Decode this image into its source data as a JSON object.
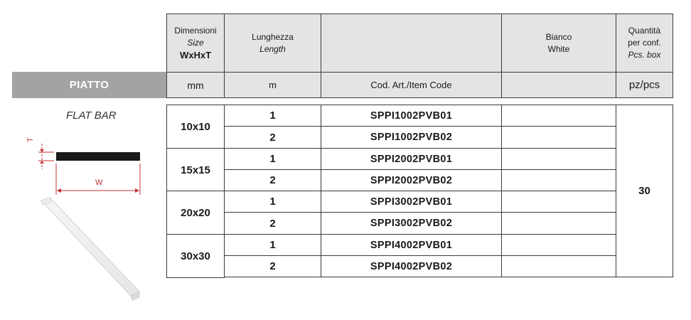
{
  "header": {
    "dim_label": "Dimensioni",
    "dim_size": "Size",
    "dim_format": "WxHxT",
    "len_label": "Lunghezza",
    "len_en": "Length",
    "color_it": "Bianco",
    "color_en": "White",
    "qty_label1": "Quantità",
    "qty_label2": "per conf.",
    "qty_en": "Pcs. box"
  },
  "units": {
    "category": "PIATTO",
    "dim": "mm",
    "len": "m",
    "code": "Cod. Art./Item Code",
    "qty": "pz/pcs"
  },
  "product": {
    "name": "FLAT BAR",
    "label_t": "T",
    "label_w": "W"
  },
  "rows": [
    {
      "size": "10x10",
      "items": [
        {
          "length": "1",
          "code": "SPPI1002PVB01"
        },
        {
          "length": "2",
          "code": "SPPI1002PVB02"
        }
      ]
    },
    {
      "size": "15x15",
      "items": [
        {
          "length": "1",
          "code": "SPPI2002PVB01"
        },
        {
          "length": "2",
          "code": "SPPI2002PVB02"
        }
      ]
    },
    {
      "size": "20x20",
      "items": [
        {
          "length": "1",
          "code": "SPPI3002PVB01"
        },
        {
          "length": "2",
          "code": "SPPI3002PVB02"
        }
      ]
    },
    {
      "size": "30x30",
      "items": [
        {
          "length": "1",
          "code": "SPPI4002PVB01"
        },
        {
          "length": "2",
          "code": "SPPI4002PVB02"
        }
      ]
    }
  ],
  "quantity": "30"
}
